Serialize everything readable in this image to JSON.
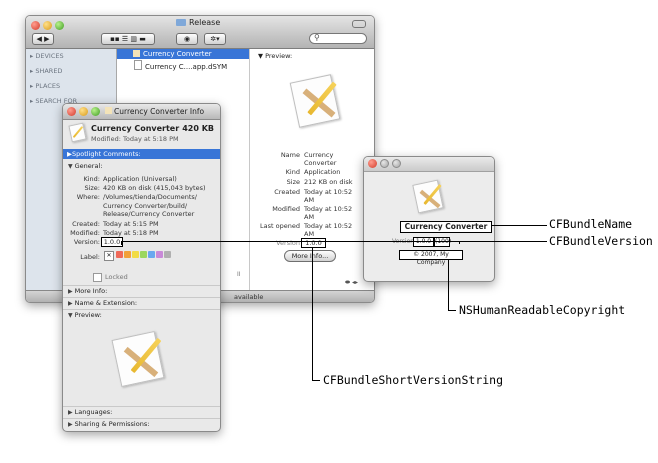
{
  "finder": {
    "title": "Release",
    "sidebar": [
      "DEVICES",
      "SHARED",
      "PLACES",
      "SEARCH FOR"
    ],
    "files": [
      {
        "name": "Currency Converter",
        "selected": true
      },
      {
        "name": "Currency C....app.dSYM",
        "selected": false
      }
    ],
    "preview_label": "Preview:",
    "info": [
      {
        "k": "Name",
        "v": "Currency Converter"
      },
      {
        "k": "Kind",
        "v": "Application"
      },
      {
        "k": "Size",
        "v": "212 KB on disk"
      },
      {
        "k": "Created",
        "v": "Today at 10:52 AM"
      },
      {
        "k": "Modified",
        "v": "Today at 10:52 AM"
      },
      {
        "k": "Last opened",
        "v": "Today at 10:52 AM"
      },
      {
        "k": "Version",
        "v": "1.0.0"
      }
    ],
    "more_info_button": "More Info...",
    "status": "available"
  },
  "info_window": {
    "title": "Currency Converter Info",
    "app_name": "Currency Converter",
    "app_size": "420 KB",
    "modified": "Modified: Today at 5:18 PM",
    "spotlight": "Spotlight Comments:",
    "general": "General:",
    "general_rows": [
      {
        "k": "Kind:",
        "v": "Application (Universal)"
      },
      {
        "k": "Size:",
        "v": "420 KB on disk (415,043 bytes)"
      },
      {
        "k": "Where:",
        "v": "/Volumes/tienda/Documents/ Currency Converter/build/ Release/Currency Converter"
      },
      {
        "k": "Created:",
        "v": "Today at 5:15 PM"
      },
      {
        "k": "Modified:",
        "v": "Today at 5:18 PM"
      }
    ],
    "version_label": "Version:",
    "version": "1.0.0",
    "label_label": "Label:",
    "locked": "Locked",
    "more_info": "More Info:",
    "name_ext": "Name & Extension:",
    "preview": "Preview:",
    "languages": "Languages:",
    "sharing": "Sharing & Permissions:"
  },
  "about_window": {
    "app_name": "Currency Converter",
    "version_label": "Version",
    "version": "1.0.0",
    "build": "(100)",
    "copyright": "© 2007, My Company"
  },
  "callouts": {
    "bundle_name": "CFBundleName",
    "bundle_version": "CFBundleVersion",
    "copyright": "NSHumanReadableCopyright",
    "short_version": "CFBundleShortVersionString"
  },
  "label_colors": [
    "#f06a5a",
    "#f2a13a",
    "#f2dc46",
    "#9bd760",
    "#6aa8ef",
    "#c98ad8",
    "#b0b0b0"
  ]
}
